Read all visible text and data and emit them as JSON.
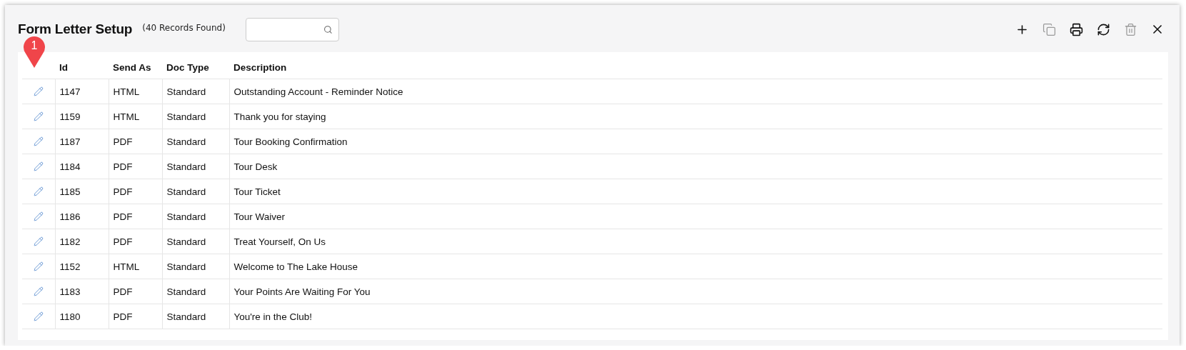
{
  "window": {
    "title": "Form Letter Setup",
    "record_count": "(40 Records Found)"
  },
  "toolbar": [
    {
      "kind": "add",
      "disabled": false
    },
    {
      "kind": "copy",
      "disabled": true
    },
    {
      "kind": "print",
      "disabled": false
    },
    {
      "kind": "refresh",
      "disabled": false
    },
    {
      "kind": "delete",
      "disabled": true
    },
    {
      "kind": "close",
      "disabled": false
    }
  ],
  "callout": {
    "label": "1"
  },
  "table": {
    "columns": [
      "Id",
      "Send As",
      "Doc Type",
      "Description"
    ],
    "rows": [
      [
        "1147",
        "HTML",
        "Standard",
        "Outstanding Account - Reminder Notice"
      ],
      [
        "1159",
        "HTML",
        "Standard",
        "Thank you for staying"
      ],
      [
        "1187",
        "PDF",
        "Standard",
        "Tour Booking Confirmation"
      ],
      [
        "1184",
        "PDF",
        "Standard",
        "Tour Desk"
      ],
      [
        "1185",
        "PDF",
        "Standard",
        "Tour Ticket"
      ],
      [
        "1186",
        "PDF",
        "Standard",
        "Tour Waiver"
      ],
      [
        "1182",
        "PDF",
        "Standard",
        "Treat Yourself, On Us"
      ],
      [
        "1152",
        "HTML",
        "Standard",
        "Welcome to The Lake House"
      ],
      [
        "1183",
        "PDF",
        "Standard",
        "Your Points Are Waiting For You"
      ],
      [
        "1180",
        "PDF",
        "Standard",
        "You're in the Club!"
      ]
    ]
  }
}
